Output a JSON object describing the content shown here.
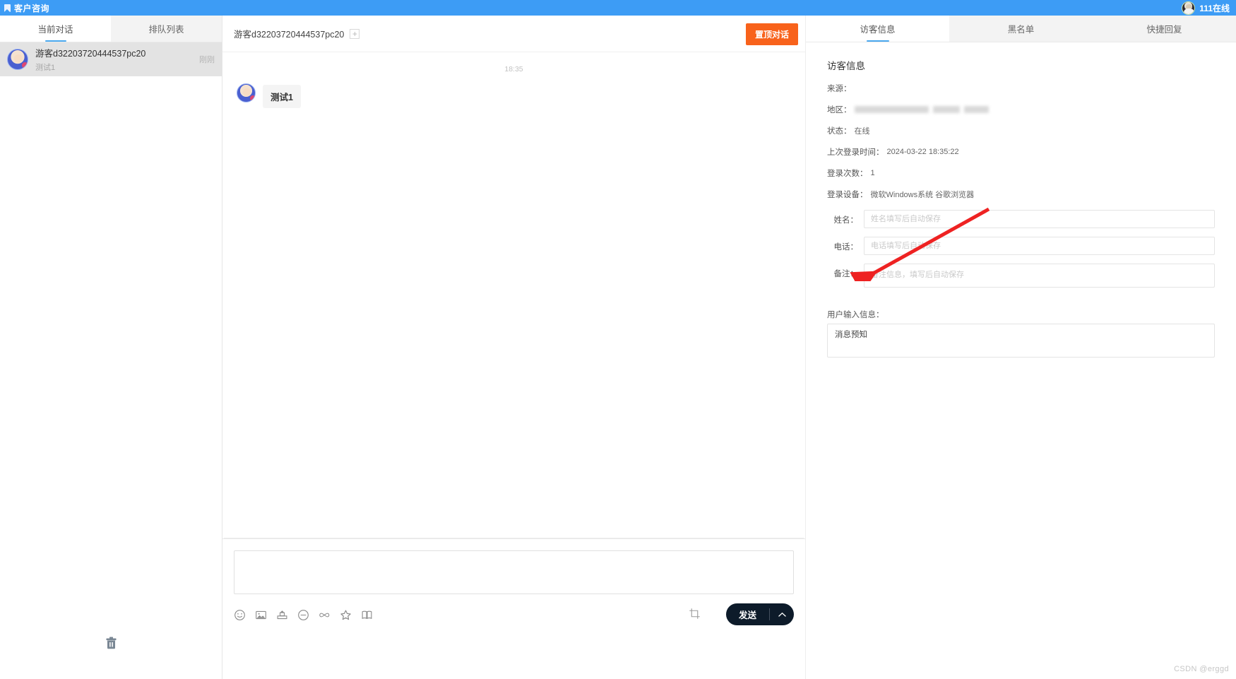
{
  "topbar": {
    "title": "客户咨询",
    "flag_icon": "flag-icon",
    "online_count": "111在线"
  },
  "sidebar": {
    "tabs": [
      {
        "label": "当前对话",
        "active": true
      },
      {
        "label": "排队列表",
        "active": false
      }
    ],
    "conversations": [
      {
        "name": "游客d32203720444537pc20",
        "preview": "测试1",
        "time": "刚刚"
      }
    ],
    "delete_icon": "trash-icon"
  },
  "chat": {
    "title": "游客d32203720444537pc20",
    "add_tag_label": "+",
    "pin_button": "置顶对话",
    "timestamp": "18:35",
    "messages": [
      {
        "sender": "visitor",
        "text": "测试1"
      }
    ],
    "composer": {
      "value": "",
      "placeholder": ""
    },
    "tools": [
      "emoji-icon",
      "image-icon",
      "file-upload-icon",
      "minus-circle-icon",
      "link-icon",
      "star-icon",
      "book-icon"
    ],
    "crop_icon": "crop-icon",
    "send_label": "发送",
    "send_caret_icon": "chevron-up-icon"
  },
  "right_panel": {
    "tabs": [
      {
        "label": "访客信息",
        "active": true
      },
      {
        "label": "黑名单",
        "active": false
      },
      {
        "label": "快捷回复",
        "active": false
      }
    ],
    "heading": "访客信息",
    "info": {
      "source_label": "来源：",
      "source_value": "",
      "region_label": "地区：",
      "region_value": "",
      "status_label": "状态：",
      "status_value": "在线",
      "last_login_label": "上次登录时间：",
      "last_login_value": "2024-03-22 18:35:22",
      "login_count_label": "登录次数：",
      "login_count_value": "1",
      "device_label": "登录设备：",
      "device_value": "微软Windows系统 谷歌浏览器"
    },
    "form": {
      "name_label": "姓名：",
      "name_value": "",
      "name_placeholder": "姓名填写后自动保存",
      "phone_label": "电话：",
      "phone_value": "",
      "phone_placeholder": "电话填写后自动保存",
      "remark_label": "备注：",
      "remark_value": "",
      "remark_placeholder": "备注信息，填写后自动保存"
    },
    "user_input": {
      "label": "用户输入信息：",
      "value": "消息预知"
    }
  },
  "annotation": {
    "arrow_color": "#ee2222"
  },
  "watermark": "CSDN @erggd"
}
